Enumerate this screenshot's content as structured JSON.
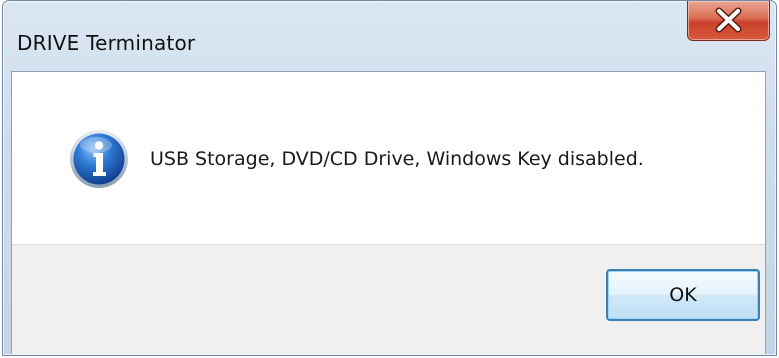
{
  "window": {
    "title": "DRIVE Terminator"
  },
  "titlebar": {
    "close_icon": "close-icon"
  },
  "message": {
    "icon": "info-icon",
    "text": "USB Storage, DVD/CD Drive, Windows Key disabled."
  },
  "buttons": {
    "ok_label": "OK"
  },
  "colors": {
    "close_button": "#c8412a",
    "info_icon": "#1f5fb8",
    "ok_border": "#3c7fb1",
    "button_bar": "#f0f0f0"
  }
}
